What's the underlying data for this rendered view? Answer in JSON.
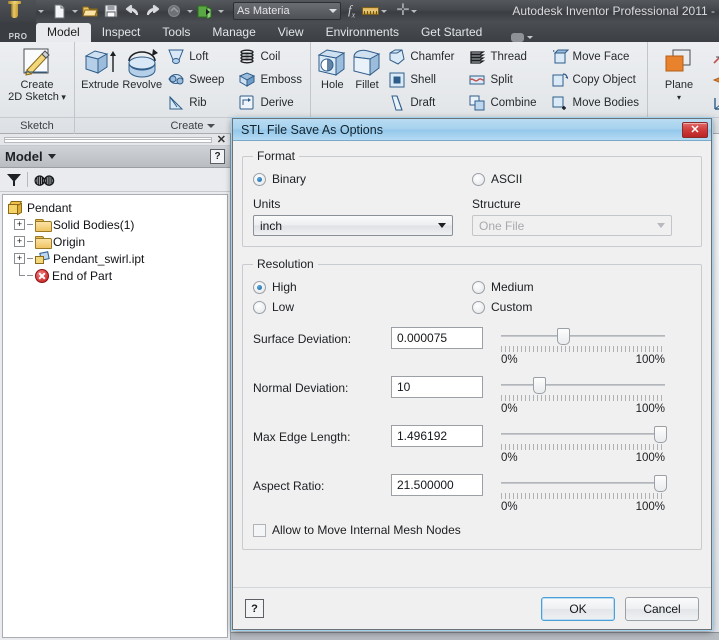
{
  "titlebar": {
    "app_title": "Autodesk Inventor Professional 2011 -",
    "quick_access": [
      {
        "name": "new-file-icon",
        "glyph": "new"
      },
      {
        "name": "open-file-icon",
        "glyph": "open"
      },
      {
        "name": "save-file-icon",
        "glyph": "save"
      },
      {
        "name": "undo-icon",
        "glyph": "undo"
      },
      {
        "name": "redo-icon",
        "glyph": "redo"
      },
      {
        "name": "update-icon",
        "glyph": "update"
      },
      {
        "name": "return-icon",
        "glyph": "return"
      }
    ],
    "material_combo_value": "As Materia",
    "fx_label": "fx"
  },
  "ribbon": {
    "tabs": [
      {
        "label": "Model",
        "active": true
      },
      {
        "label": "Inspect",
        "active": false
      },
      {
        "label": "Tools",
        "active": false
      },
      {
        "label": "Manage",
        "active": false
      },
      {
        "label": "View",
        "active": false
      },
      {
        "label": "Environments",
        "active": false
      },
      {
        "label": "Get Started",
        "active": false
      }
    ],
    "pro_badge": "PRO",
    "panels": [
      {
        "caption": "Sketch",
        "has_caret": false,
        "big": [
          {
            "label": "Create",
            "label2": "2D Sketch",
            "name": "create-2d-sketch-button"
          }
        ],
        "small": []
      },
      {
        "caption": "Create",
        "has_caret": true,
        "big": [
          {
            "label": "Extrude",
            "name": "extrude-button"
          },
          {
            "label": "Revolve",
            "name": "revolve-button"
          }
        ],
        "small": [
          [
            "Loft",
            "Sweep",
            "Rib"
          ],
          [
            "Coil",
            "Emboss",
            "Derive"
          ]
        ]
      },
      {
        "caption": "",
        "has_caret": false,
        "big": [
          {
            "label": "Hole",
            "name": "hole-button"
          },
          {
            "label": "Fillet",
            "name": "fillet-button"
          }
        ],
        "small": [
          [
            "Chamfer",
            "Shell",
            "Draft"
          ],
          [
            "Thread",
            "Split",
            "Combine"
          ],
          [
            "Move Face",
            "Copy Object",
            "Move Bodies"
          ]
        ]
      },
      {
        "caption": "",
        "has_caret": false,
        "big": [
          {
            "label": "Plane",
            "label2": "",
            "name": "plane-button"
          }
        ],
        "small": []
      }
    ]
  },
  "browser": {
    "title": "Model",
    "help_glyph": "?",
    "filter_icon": "filter-icon",
    "find_icon": "binoculars-icon",
    "close_glyph": "✕",
    "tree": [
      {
        "label": "Pendant",
        "level": 1,
        "expander": "",
        "icon": "part-icon"
      },
      {
        "label": "Solid Bodies(1)",
        "level": 2,
        "expander": "+",
        "icon": "solid-bodies-icon"
      },
      {
        "label": "Origin",
        "level": 2,
        "expander": "+",
        "icon": "folder-icon"
      },
      {
        "label": "Pendant_swirl.ipt",
        "level": 2,
        "expander": "+",
        "icon": "sketch-icon"
      },
      {
        "label": "End of Part",
        "level": 2,
        "expander": "",
        "icon": "end-of-part-icon"
      }
    ]
  },
  "dialog": {
    "title": "STL File Save As Options",
    "close_glyph": "✕",
    "format": {
      "legend": "Format",
      "binary_label": "Binary",
      "binary_selected": true,
      "ascii_label": "ASCII",
      "ascii_selected": false,
      "units_label": "Units",
      "units_value": "inch",
      "structure_label": "Structure",
      "structure_value": "One File",
      "structure_disabled": true
    },
    "resolution": {
      "legend": "Resolution",
      "high_label": "High",
      "high_selected": true,
      "medium_label": "Medium",
      "medium_selected": false,
      "low_label": "Low",
      "low_selected": false,
      "custom_label": "Custom",
      "custom_selected": false,
      "fields": [
        {
          "label": "Surface Deviation:",
          "value": "0.000075",
          "slider_pct": 38,
          "min_label": "0%",
          "max_label": "100%"
        },
        {
          "label": "Normal Deviation:",
          "value": "10",
          "slider_pct": 23,
          "min_label": "0%",
          "max_label": "100%"
        },
        {
          "label": "Max Edge Length:",
          "value": "1.496192",
          "slider_pct": 97,
          "min_label": "0%",
          "max_label": "100%"
        },
        {
          "label": "Aspect Ratio:",
          "value": "21.500000",
          "slider_pct": 97,
          "min_label": "0%",
          "max_label": "100%"
        }
      ],
      "allow_move_label": "Allow to Move Internal Mesh Nodes",
      "allow_move_checked": false
    },
    "footer": {
      "help_glyph": "?",
      "ok_label": "OK",
      "cancel_label": "Cancel"
    }
  },
  "colors": {
    "dialog_title_blue": "#a6d2ee",
    "close_red": "#cf3a3a",
    "accent_focus": "#4ba0d8",
    "ribbon_bg": "#e8eaed"
  }
}
